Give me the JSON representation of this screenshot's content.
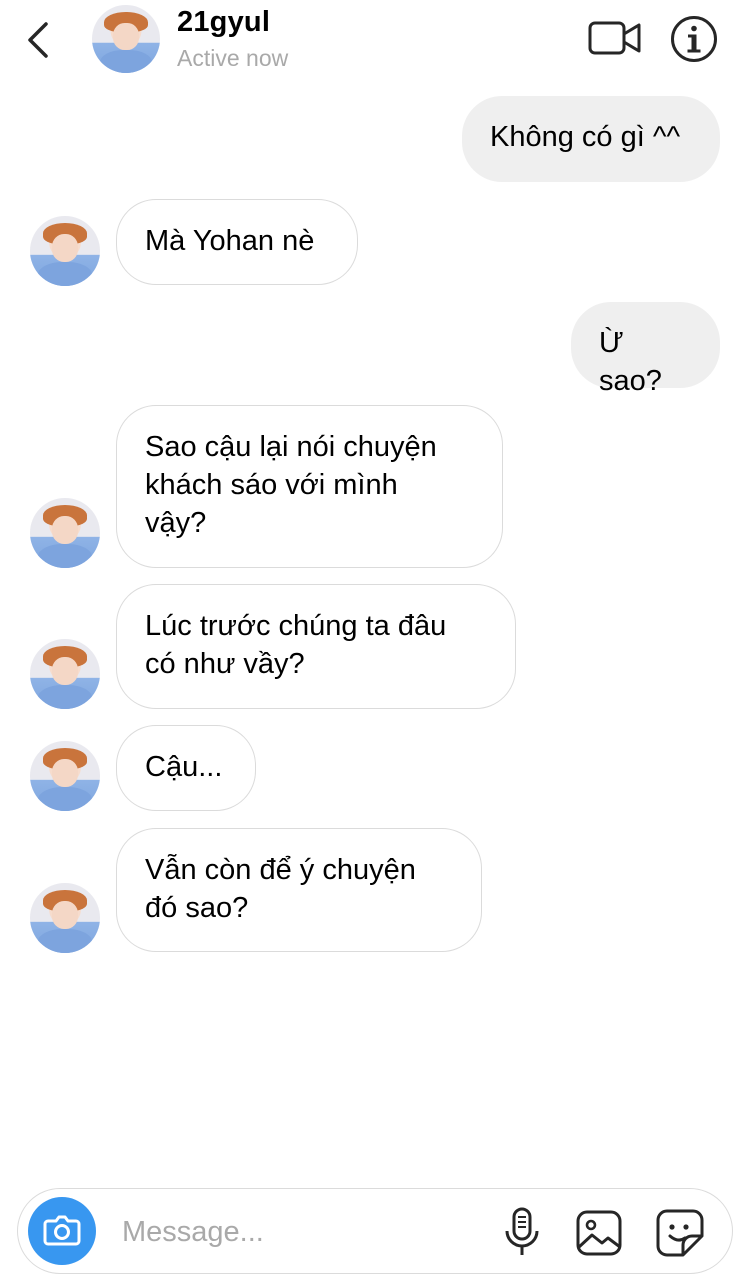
{
  "header": {
    "username": "21gyul",
    "status": "Active now",
    "icons": [
      "back-chevron-icon",
      "video-call-icon",
      "info-icon"
    ]
  },
  "messages": [
    {
      "sender": "me",
      "text": "Không có gì ^^"
    },
    {
      "sender": "them",
      "text": "Mà Yohan nè"
    },
    {
      "sender": "me",
      "text": "Ừ sao?"
    },
    {
      "sender": "them",
      "text": "Sao cậu lại nói chuyện\nkhách sáo với mình\nvậy?"
    },
    {
      "sender": "them",
      "text": "Lúc trước chúng ta đâu\ncó như vầy?"
    },
    {
      "sender": "them",
      "text": "Cậu..."
    },
    {
      "sender": "them",
      "text": "Vẫn còn để ý chuyện\nđó sao?"
    }
  ],
  "composer": {
    "placeholder": "Message...",
    "icons": [
      "camera-icon",
      "microphone-icon",
      "gallery-icon",
      "sticker-icon"
    ]
  },
  "colors": {
    "outgoing_bubble": "#efefef",
    "incoming_border": "#dbdbdb",
    "camera_button": "#3897f0",
    "muted_text": "#a9a9a9"
  }
}
